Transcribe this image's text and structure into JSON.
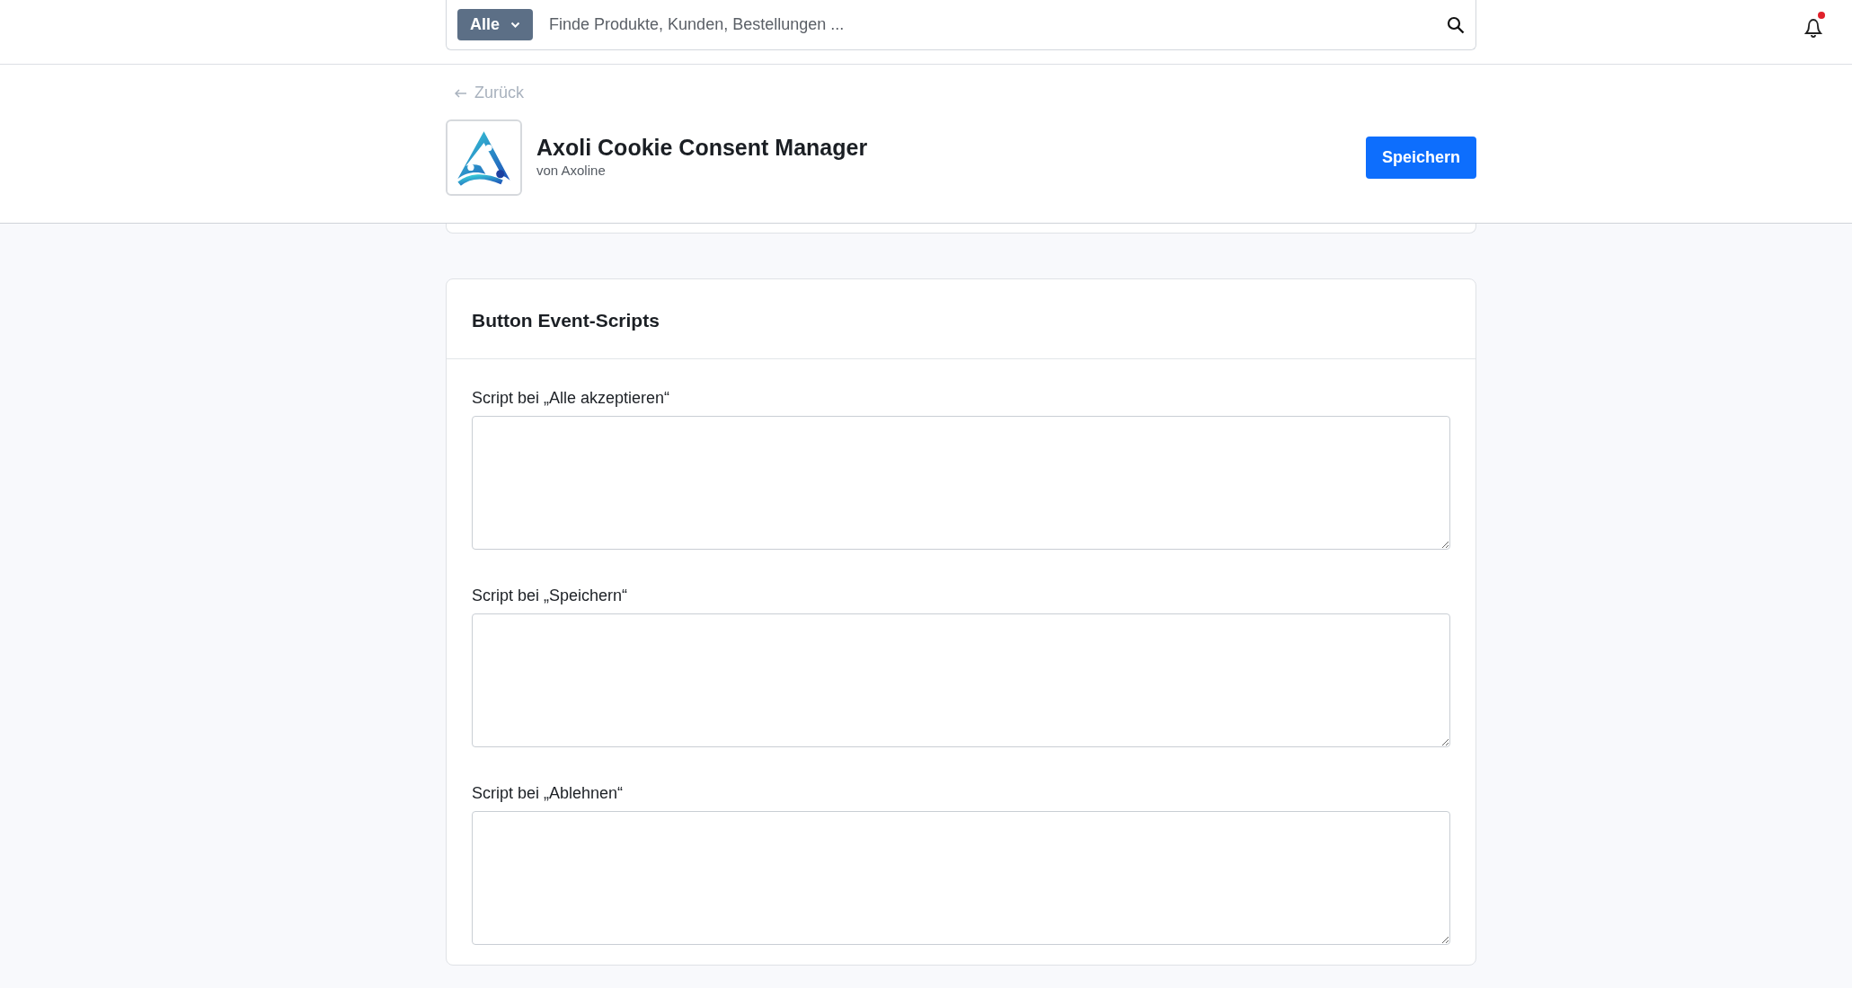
{
  "top_bar": {
    "scope_dropdown": "Alle",
    "search": {
      "placeholder": "Finde Produkte, Kunden, Bestellungen ..."
    },
    "notifications": {
      "unread": true
    }
  },
  "header": {
    "back_link": "Zurück",
    "app_title": "Axoli Cookie Consent Manager",
    "vendor": "von Axoline",
    "save_button": "Speichern"
  },
  "card": {
    "title": "Button Event-Scripts",
    "fields": [
      {
        "label": "Script bei „Alle akzeptieren“"
      },
      {
        "label": "Script bei „Speichern“"
      },
      {
        "label": "Script bei „Ablehnen“"
      }
    ]
  }
}
